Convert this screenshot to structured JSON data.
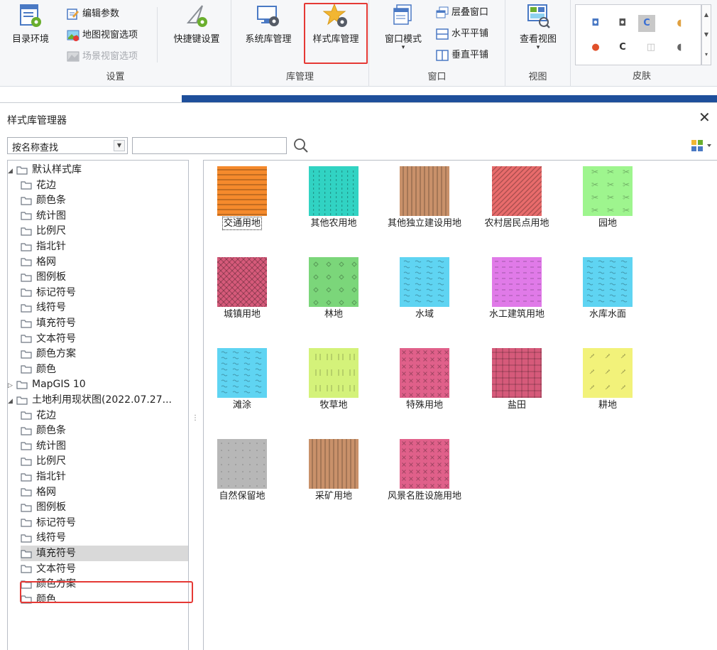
{
  "ribbon": {
    "groups": [
      {
        "label": "设置"
      },
      {
        "label": "库管理"
      },
      {
        "label": "窗口"
      },
      {
        "label": "视图"
      },
      {
        "label": "皮肤"
      }
    ],
    "catalog_env": "目录环境",
    "edit_params": "编辑参数",
    "map_view_options": "地图视窗选项",
    "scene_view_options": "场景视窗选项",
    "shortcut_settings": "快捷键设置",
    "system_lib_manager": "系统库管理",
    "style_lib_manager": "样式库管理",
    "window_mode": "窗口模式",
    "cascade": "层叠窗口",
    "tile_horizontal": "水平平铺",
    "tile_vertical": "垂直平铺",
    "view_views": "查看视图"
  },
  "dialog": {
    "title": "样式库管理器",
    "search_mode": "按名称查找",
    "search_value": ""
  },
  "tree": {
    "root1": "默认样式库",
    "root2": "MapGIS 10",
    "root3": "土地利用现状图(2022.07.27...",
    "children": [
      "花边",
      "颜色条",
      "统计图",
      "比例尺",
      "指北针",
      "格网",
      "图例板",
      "标记符号",
      "线符号",
      "填充符号",
      "文本符号",
      "颜色方案",
      "颜色"
    ]
  },
  "symbols": [
    {
      "label": "交通用地",
      "color": "#f58a2c",
      "pattern": "hlines"
    },
    {
      "label": "其他农用地",
      "color": "#31d3c3",
      "pattern": "dots-v"
    },
    {
      "label": "其他独立建设用地",
      "color": "#c9916a",
      "pattern": "vlines"
    },
    {
      "label": "农村居民点用地",
      "color": "#e86b6b",
      "pattern": "diag"
    },
    {
      "label": "园地",
      "color": "#9ef58e",
      "pattern": "scissors"
    },
    {
      "label": "城镇用地",
      "color": "#d65a7a",
      "pattern": "crosshatch"
    },
    {
      "label": "林地",
      "color": "#7bd67a",
      "pattern": "diamonds"
    },
    {
      "label": "水域",
      "color": "#5fd4f2",
      "pattern": "waves"
    },
    {
      "label": "水工建筑用地",
      "color": "#e07ae8",
      "pattern": "dashgrid"
    },
    {
      "label": "水库水面",
      "color": "#5fd4f2",
      "pattern": "waves"
    },
    {
      "label": "滩涂",
      "color": "#5fd4f2",
      "pattern": "waves"
    },
    {
      "label": "牧草地",
      "color": "#d4f27a",
      "pattern": "ticks"
    },
    {
      "label": "特殊用地",
      "color": "#e0608a",
      "pattern": "xs"
    },
    {
      "label": "盐田",
      "color": "#d65a7a",
      "pattern": "grid"
    },
    {
      "label": "耕地",
      "color": "#f2f27a",
      "pattern": "sprouts"
    },
    {
      "label": "自然保留地",
      "color": "#b7b7b7",
      "pattern": "sparsedots"
    },
    {
      "label": "采矿用地",
      "color": "#c9916a",
      "pattern": "vlines"
    },
    {
      "label": "风景名胜设施用地",
      "color": "#e0608a",
      "pattern": "xs"
    }
  ]
}
